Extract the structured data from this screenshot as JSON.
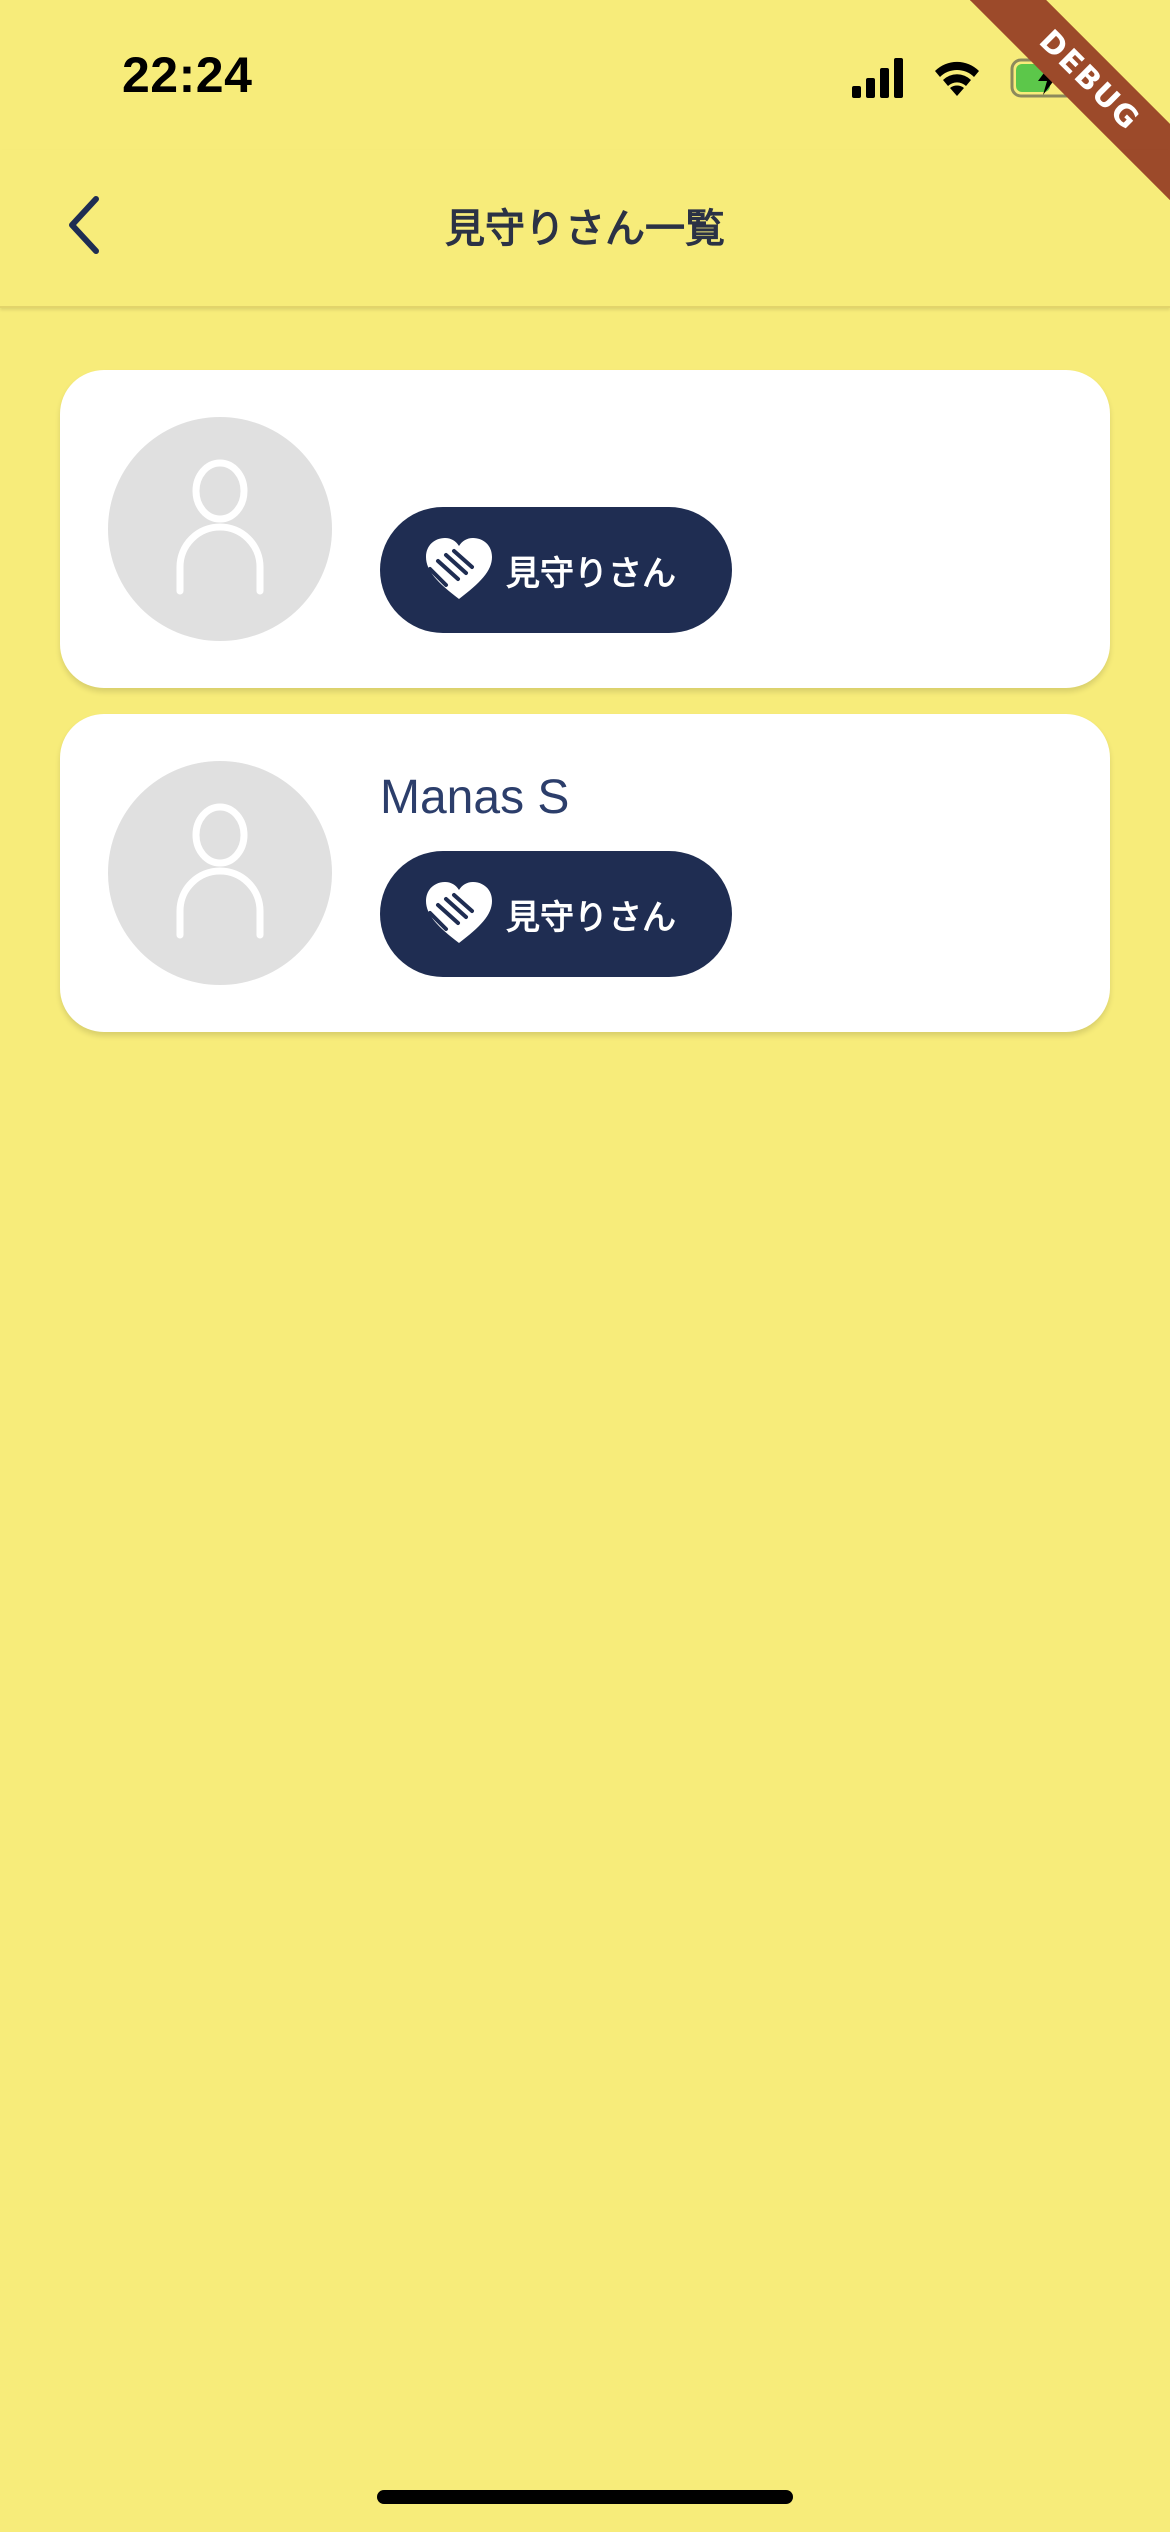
{
  "status_bar": {
    "time": "22:24",
    "icons": [
      "signal-icon",
      "wifi-icon",
      "battery-charging-icon"
    ]
  },
  "debug_banner": "DEBUG",
  "app_bar": {
    "title": "見守りさん一覧",
    "back_icon": "chevron-left-icon"
  },
  "cards": [
    {
      "name": "",
      "role_label": "見守りさん",
      "avatar_icon": "person-icon",
      "badge_icon": "heart-hand-icon"
    },
    {
      "name": "Manas S",
      "role_label": "見守りさん",
      "avatar_icon": "person-icon",
      "badge_icon": "heart-hand-icon"
    }
  ],
  "colors": {
    "background": "#F7EC7A",
    "card": "#FFFFFF",
    "badge": "#1F2D52",
    "avatar": "#E0E0E0",
    "debug_ribbon": "#9C4A2A"
  }
}
